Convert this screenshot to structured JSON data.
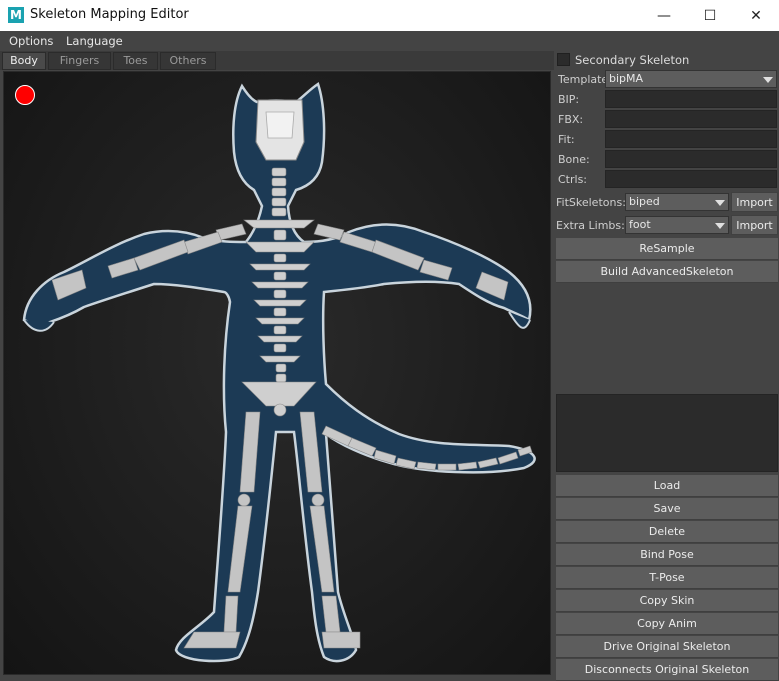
{
  "window": {
    "title": "Skeleton Mapping Editor",
    "app_icon_letter": "M",
    "minimize_glyph": "—",
    "maximize_glyph": "☐",
    "close_glyph": "✕"
  },
  "menu": {
    "items": [
      "Options",
      "Language"
    ]
  },
  "tabs": [
    {
      "label": "Body",
      "active": true
    },
    {
      "label": "Fingers",
      "active": false
    },
    {
      "label": "Toes",
      "active": false
    },
    {
      "label": "Others",
      "active": false
    }
  ],
  "viewport": {
    "status_color": "#ff0000",
    "body_fill": "#1c3a55",
    "outline_color": "#c9d4dc",
    "bone_color": "#bdbdbd"
  },
  "panel": {
    "secondary_skeleton": {
      "label": "Secondary Skeleton",
      "checked": false
    },
    "template": {
      "label": "Template",
      "value": "bipMA"
    },
    "fields": [
      {
        "label": "BIP:",
        "value": ""
      },
      {
        "label": "FBX:",
        "value": ""
      },
      {
        "label": "Fit:",
        "value": ""
      },
      {
        "label": "Bone:",
        "value": ""
      },
      {
        "label": "Ctrls:",
        "value": ""
      }
    ],
    "fit_skeletons": {
      "label": "FitSkeletons:",
      "value": "biped",
      "button": "Import"
    },
    "extra_limbs": {
      "label": "Extra Limbs:",
      "value": "foot",
      "button": "Import"
    },
    "resample_label": "ReSample",
    "build_label": "Build AdvancedSkeleton",
    "actions": [
      "Load",
      "Save",
      "Delete",
      "Bind Pose",
      "T-Pose",
      "Copy Skin",
      "Copy Anim",
      "Drive Original Skeleton",
      "Disconnects Original Skeleton"
    ]
  }
}
